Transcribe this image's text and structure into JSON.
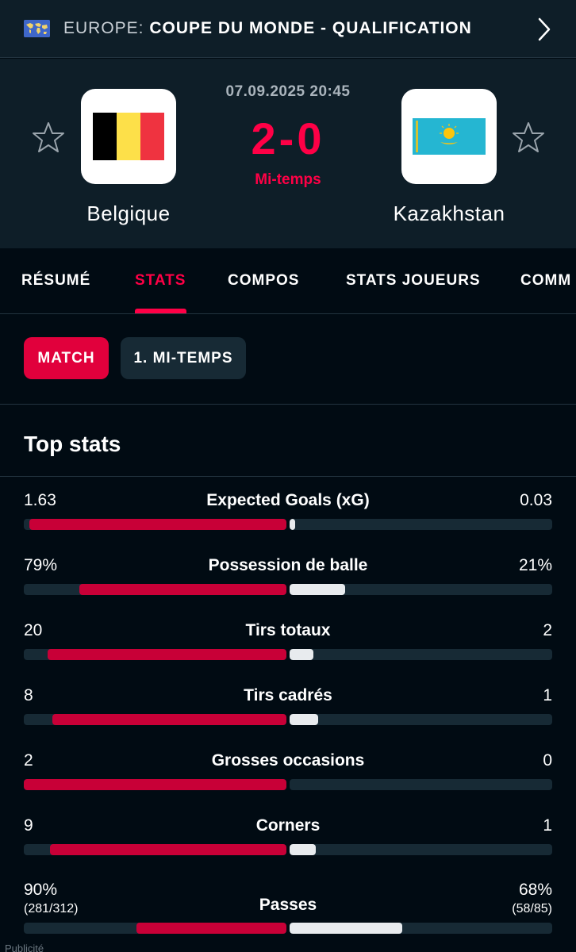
{
  "competition": {
    "region": "EUROPE:",
    "name": "COUPE DU MONDE - QUALIFICATION"
  },
  "match": {
    "datetime": "07.09.2025 20:45",
    "score": "2-0",
    "status": "Mi-temps",
    "home_team": "Belgique",
    "away_team": "Kazakhstan"
  },
  "tabs": [
    "RÉSUMÉ",
    "STATS",
    "COMPOS",
    "STATS JOUEURS",
    "COMM"
  ],
  "active_tab": "STATS",
  "period_filters": [
    "MATCH",
    "1. MI-TEMPS"
  ],
  "active_period": "MATCH",
  "section_title": "Top stats",
  "stats": [
    {
      "label": "Expected Goals (xG)",
      "home": "1.63",
      "away": "0.03",
      "home_share": 0.98,
      "away_share": 0.02
    },
    {
      "label": "Possession de balle",
      "home": "79%",
      "away": "21%",
      "home_share": 0.79,
      "away_share": 0.21
    },
    {
      "label": "Tirs totaux",
      "home": "20",
      "away": "2",
      "home_share": 0.91,
      "away_share": 0.09
    },
    {
      "label": "Tirs cadrés",
      "home": "8",
      "away": "1",
      "home_share": 0.89,
      "away_share": 0.11
    },
    {
      "label": "Grosses occasions",
      "home": "2",
      "away": "0",
      "home_share": 1.0,
      "away_share": 0.0
    },
    {
      "label": "Corners",
      "home": "9",
      "away": "1",
      "home_share": 0.9,
      "away_share": 0.1
    },
    {
      "label": "Passes",
      "home": "90%",
      "home_detail": "(281/312)",
      "away": "68%",
      "away_detail": "(58/85)",
      "home_share": 0.57,
      "away_share": 0.43
    }
  ],
  "ad_label": "Publicité",
  "colors": {
    "accent": "#ff0046",
    "home_bar": "#c80037",
    "away_bar": "#e8ebee",
    "bar_track": "#172a35",
    "header_bg": "#0e1e28",
    "page_bg": "#010b13"
  },
  "icons": {
    "competition": "world-map-flag-icon",
    "navigate": "chevron-right-icon",
    "favorite": "star-outline-icon"
  }
}
